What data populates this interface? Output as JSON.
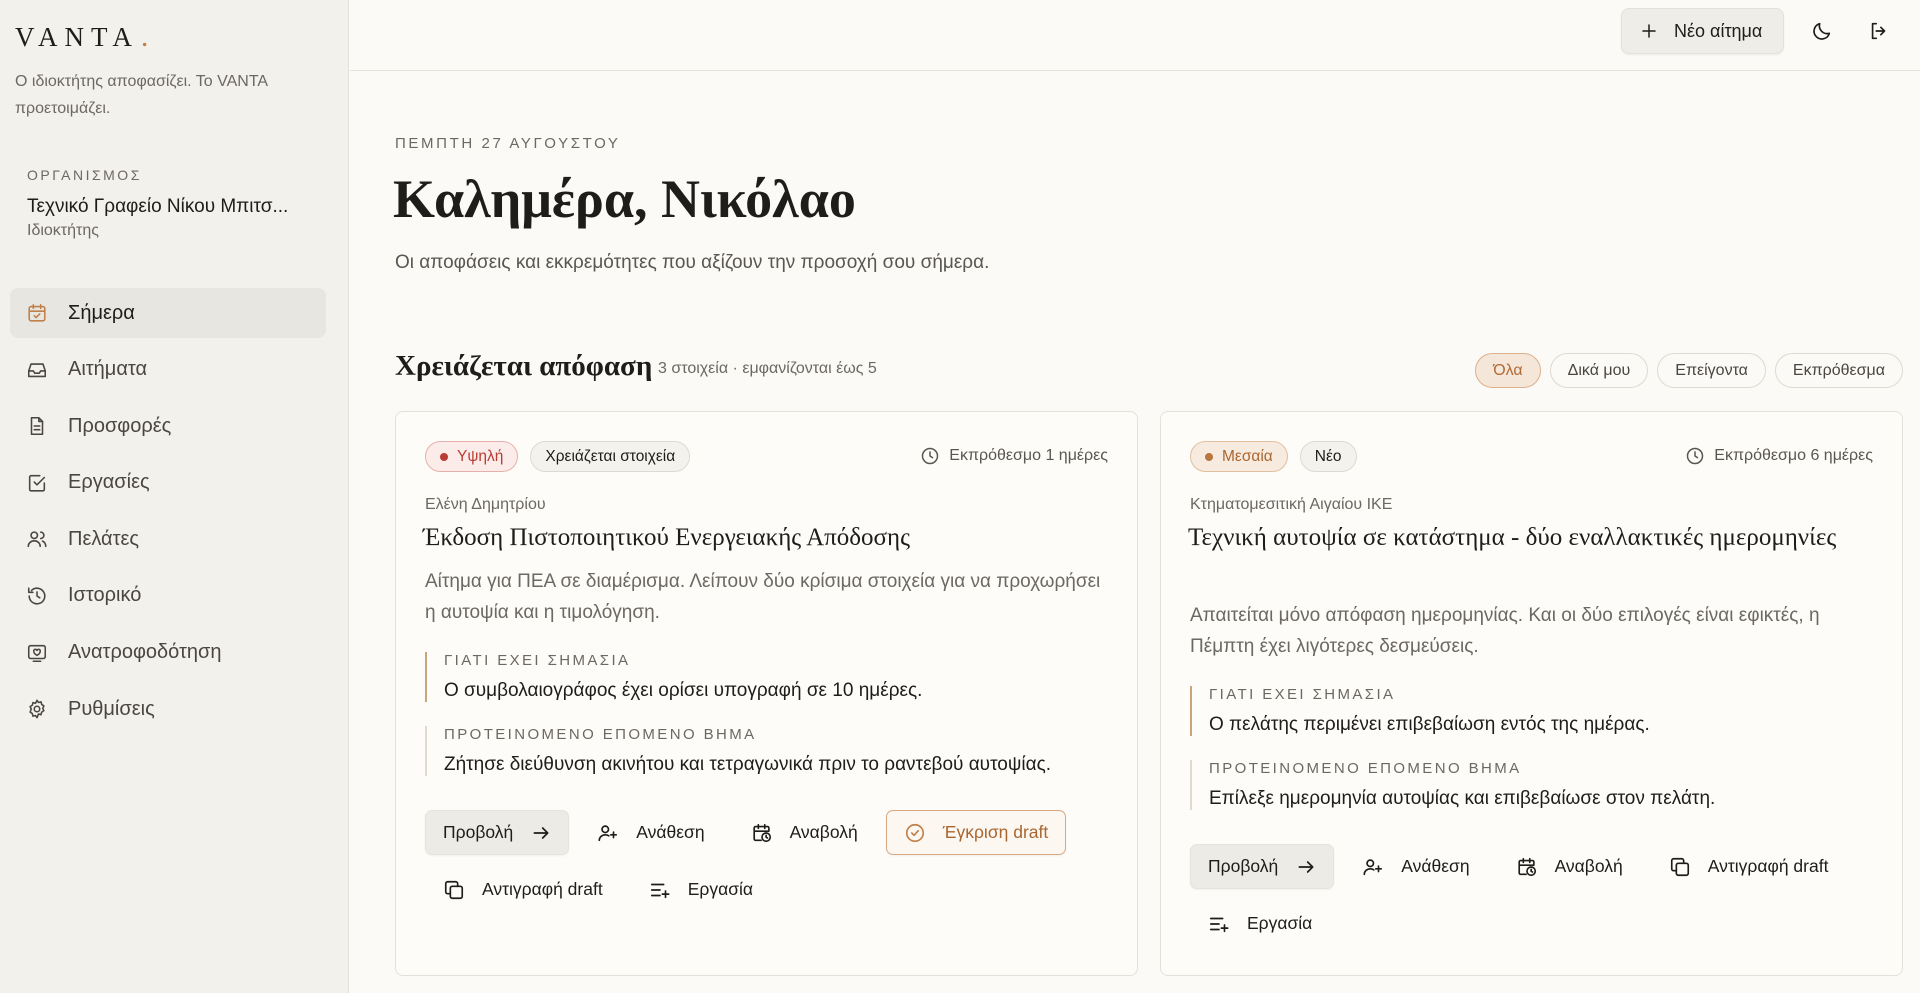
{
  "brand": {
    "name": "VANTA",
    "dot": ".",
    "tagline": "Ο ιδιοκτήτης αποφασίζει. Το VANTA προετοιμάζει."
  },
  "organization": {
    "label": "ΟΡΓΑΝΙΣΜΟΣ",
    "name": "Τεχνικό Γραφείο Νίκου Μπιτσ...",
    "role": "Ιδιοκτήτης"
  },
  "nav": {
    "items": [
      {
        "label": "Σήμερα",
        "icon": "calendar-check-icon",
        "active": true
      },
      {
        "label": "Αιτήματα",
        "icon": "inbox-icon"
      },
      {
        "label": "Προσφορές",
        "icon": "document-icon"
      },
      {
        "label": "Εργασίες",
        "icon": "checkbox-icon"
      },
      {
        "label": "Πελάτες",
        "icon": "users-icon"
      },
      {
        "label": "Ιστορικό",
        "icon": "history-icon"
      },
      {
        "label": "Ανατροφοδότηση",
        "icon": "feedback-icon"
      },
      {
        "label": "Ρυθμίσεις",
        "icon": "gear-icon"
      }
    ]
  },
  "topbar": {
    "new_request_label": "Νέο αίτημα",
    "theme_icon": "moon-icon",
    "logout_icon": "logout-icon"
  },
  "header": {
    "date": "ΠΕΜΠΤΗ 27 ΑΥΓΟΥΣΤΟΥ",
    "greeting": "Καλημέρα, Νικόλαο",
    "subtitle": "Οι αποφάσεις και εκκρεμότητες που αξίζουν την προσοχή σου σήμερα."
  },
  "section": {
    "title": "Χρειάζεται απόφαση",
    "meta": "3 στοιχεία · εμφανίζονται έως 5",
    "filters": [
      "Όλα",
      "Δικά μου",
      "Επείγοντα",
      "Εκπρόθεσμα"
    ],
    "active_filter": "Όλα"
  },
  "colors": {
    "accent": "#c0804a",
    "high": "#b83c34",
    "medium": "#a9662f"
  },
  "cards": [
    {
      "priority": "Υψηλή",
      "tag": "Χρειάζεται στοιχεία",
      "deadline": "Εκπρόθεσμο 1 ημέρες",
      "client": "Ελένη Δημητρίου",
      "title": "Έκδοση Πιστοποιητικού Ενεργειακής Απόδοσης",
      "description": "Αίτημα για ΠΕΑ σε διαμέρισμα. Λείπουν δύο κρίσιμα στοιχεία για να προχωρήσει η αυτοψία και η τιμολόγηση.",
      "why_label": "ΓΙΑΤΙ ΕΧΕΙ ΣΗΜΑΣΙΑ",
      "why_text": "Ο συμβολαιογράφος έχει ορίσει υπογραφή σε 10 ημέρες.",
      "next_label": "ΠΡΟΤΕΙΝΟΜΕΝΟ ΕΠΟΜΕΝΟ ΒΗΜΑ",
      "next_text": "Ζήτησε διεύθυνση ακινήτου και τετραγωνικά πριν το ραντεβού αυτοψίας.",
      "actions": {
        "view": "Προβολή",
        "assign": "Ανάθεση",
        "postpone": "Αναβολή",
        "approve": "Έγκριση draft",
        "copy": "Αντιγραφή draft",
        "task": "Εργασία"
      }
    },
    {
      "priority": "Μεσαία",
      "tag": "Νέο",
      "deadline": "Εκπρόθεσμο 6 ημέρες",
      "client": "Κτηματομεσιτική Αιγαίου ΙΚΕ",
      "title": "Τεχνική αυτοψία σε κατάστημα - δύο εναλλακτικές ημερομηνίες",
      "description": "Απαιτείται μόνο απόφαση ημερομηνίας. Και οι δύο επιλογές είναι εφικτές, η Πέμπτη έχει λιγότερες δεσμεύσεις.",
      "why_label": "ΓΙΑΤΙ ΕΧΕΙ ΣΗΜΑΣΙΑ",
      "why_text": "Ο πελάτης περιμένει επιβεβαίωση εντός της ημέρας.",
      "next_label": "ΠΡΟΤΕΙΝΟΜΕΝΟ ΕΠΟΜΕΝΟ ΒΗΜΑ",
      "next_text": "Επίλεξε ημερομηνία αυτοψίας και επιβεβαίωσε στον πελάτη.",
      "actions": {
        "view": "Προβολή",
        "assign": "Ανάθεση",
        "postpone": "Αναβολή",
        "copy": "Αντιγραφή draft",
        "task": "Εργασία"
      }
    }
  ]
}
